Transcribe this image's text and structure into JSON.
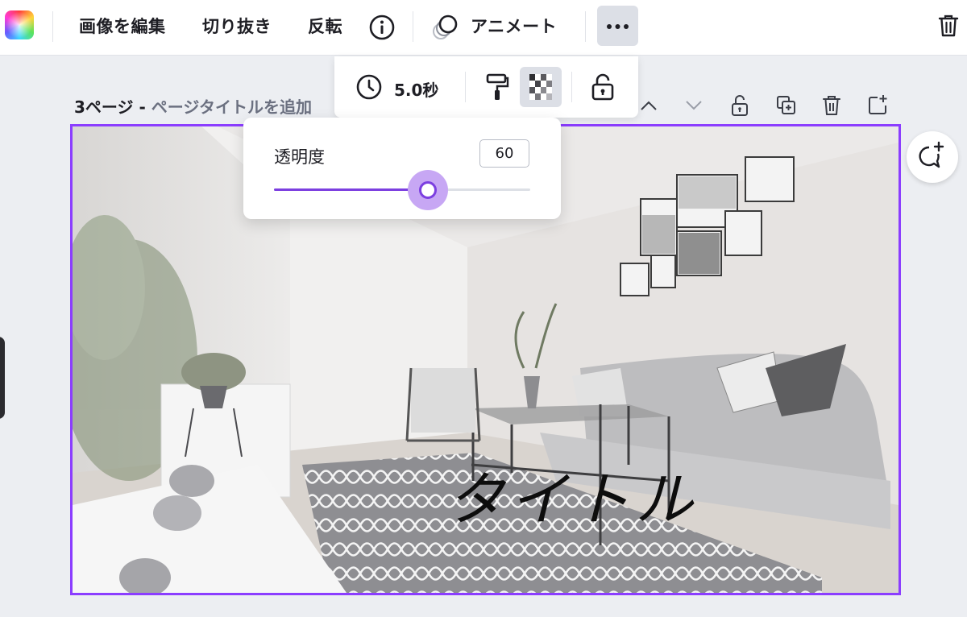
{
  "toolbar": {
    "edit_image": "画像を編集",
    "crop": "切り抜き",
    "flip": "反転",
    "animate": "アニメート"
  },
  "sub_toolbar": {
    "duration": "5.0秒"
  },
  "page": {
    "number_label": "3ページ - ",
    "title_placeholder": "ページタイトルを追加"
  },
  "canvas": {
    "title_text": "タイトル"
  },
  "opacity_popup": {
    "label": "透明度",
    "value": "60",
    "slider_fraction": 0.6
  },
  "colors": {
    "accent": "#8b3dff",
    "slider": "#7c3fe0",
    "slider_halo": "#c7a7f4"
  },
  "icons": [
    "color-palette-icon",
    "info-icon",
    "animate-icon",
    "more-icon",
    "trash-icon",
    "clock-icon",
    "paint-roller-icon",
    "transparency-icon",
    "lock-icon",
    "chevron-up-icon",
    "chevron-down-icon",
    "page-lock-icon",
    "duplicate-page-icon",
    "delete-page-icon",
    "add-page-icon",
    "add-comment-icon"
  ]
}
